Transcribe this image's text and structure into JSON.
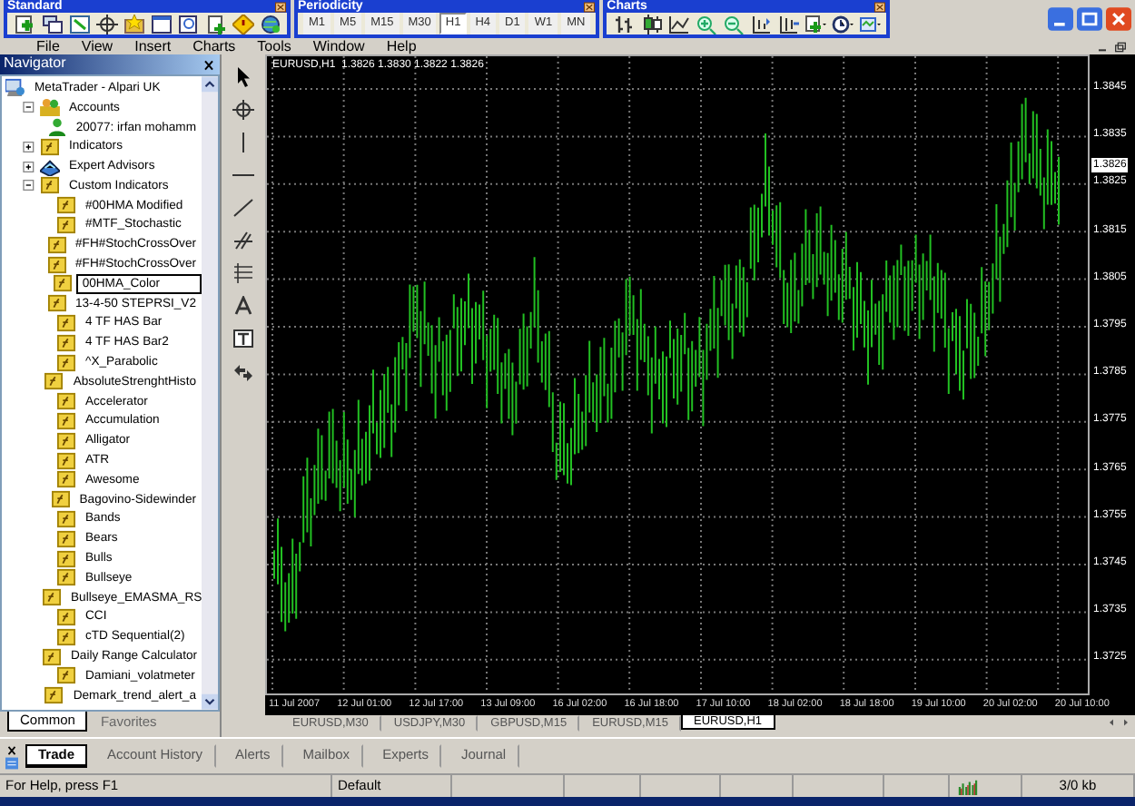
{
  "toolbars": {
    "standard": {
      "title": "Standard"
    },
    "periodicity": {
      "title": "Periodicity",
      "buttons": [
        {
          "label": "M1",
          "selected": false
        },
        {
          "label": "M5",
          "selected": false
        },
        {
          "label": "M15",
          "selected": false
        },
        {
          "label": "M30",
          "selected": false
        },
        {
          "label": "H1",
          "selected": true
        },
        {
          "label": "H4",
          "selected": false
        },
        {
          "label": "D1",
          "selected": false
        },
        {
          "label": "W1",
          "selected": false
        },
        {
          "label": "MN",
          "selected": false
        }
      ]
    },
    "charts": {
      "title": "Charts"
    }
  },
  "menu": [
    "File",
    "View",
    "Insert",
    "Charts",
    "Tools",
    "Window",
    "Help"
  ],
  "navigator": {
    "title": "Navigator",
    "tree": [
      {
        "label": "MetaTrader - Alpari UK",
        "kind": "root",
        "selected": false,
        "children": [
          {
            "label": "Accounts",
            "kind": "accounts",
            "expanded": true,
            "selected": false,
            "children": [
              {
                "label": "20077: irfan mohamm",
                "kind": "account",
                "selected": false
              }
            ]
          },
          {
            "label": "Indicators",
            "kind": "folder",
            "expanded": false,
            "selected": false
          },
          {
            "label": "Expert Advisors",
            "kind": "experts",
            "expanded": false,
            "selected": false
          },
          {
            "label": "Custom Indicators",
            "kind": "folder",
            "expanded": true,
            "selected": false,
            "children": [
              {
                "label": "#00HMA Modified",
                "kind": "script",
                "selected": false
              },
              {
                "label": "#MTF_Stochastic",
                "kind": "script",
                "selected": false
              },
              {
                "label": "#FH#StochCrossOver",
                "kind": "script",
                "selected": false
              },
              {
                "label": "#FH#StochCrossOver",
                "kind": "script",
                "selected": false
              },
              {
                "label": "00HMA_Color",
                "kind": "script",
                "selected": true
              },
              {
                "label": "13-4-50 STEPRSI_V2",
                "kind": "script",
                "selected": false
              },
              {
                "label": "4 TF HAS Bar",
                "kind": "script",
                "selected": false
              },
              {
                "label": "4 TF HAS Bar2",
                "kind": "script",
                "selected": false
              },
              {
                "label": "^X_Parabolic",
                "kind": "script",
                "selected": false
              },
              {
                "label": "AbsoluteStrenghtHisto",
                "kind": "script",
                "selected": false
              },
              {
                "label": "Accelerator",
                "kind": "script",
                "selected": false
              },
              {
                "label": "Accumulation",
                "kind": "script",
                "selected": false
              },
              {
                "label": "Alligator",
                "kind": "script",
                "selected": false
              },
              {
                "label": "ATR",
                "kind": "script",
                "selected": false
              },
              {
                "label": "Awesome",
                "kind": "script",
                "selected": false
              },
              {
                "label": "Bagovino-Sidewinder",
                "kind": "script",
                "selected": false
              },
              {
                "label": "Bands",
                "kind": "script",
                "selected": false
              },
              {
                "label": "Bears",
                "kind": "script",
                "selected": false
              },
              {
                "label": "Bulls",
                "kind": "script",
                "selected": false
              },
              {
                "label": "Bullseye",
                "kind": "script",
                "selected": false
              },
              {
                "label": "Bullseye_EMASMA_RS",
                "kind": "script",
                "selected": false
              },
              {
                "label": "CCI",
                "kind": "script",
                "selected": false
              },
              {
                "label": "cTD Sequential(2)",
                "kind": "script",
                "selected": false
              },
              {
                "label": "Daily Range Calculator",
                "kind": "script",
                "selected": false
              },
              {
                "label": "Damiani_volatmeter",
                "kind": "script",
                "selected": false
              },
              {
                "label": "Demark_trend_alert_a",
                "kind": "script",
                "selected": false
              }
            ]
          }
        ]
      }
    ],
    "tabs": [
      {
        "label": "Common",
        "selected": true
      },
      {
        "label": "Favorites",
        "selected": false
      }
    ]
  },
  "chart": {
    "header": "EURUSD,H1  1.3826 1.3830 1.3822 1.3826",
    "current_price": "1.3826",
    "price_labels": [
      "1.3845",
      "1.3835",
      "1.3825",
      "1.3815",
      "1.3805",
      "1.3795",
      "1.3785",
      "1.3775",
      "1.3765",
      "1.3755",
      "1.3745",
      "1.3735",
      "1.3725"
    ],
    "time_labels": [
      "11 Jul 2007",
      "12 Jul 01:00",
      "12 Jul 17:00",
      "13 Jul 09:00",
      "16 Jul 02:00",
      "16 Jul 18:00",
      "17 Jul 10:00",
      "18 Jul 02:00",
      "18 Jul 18:00",
      "19 Jul 10:00",
      "20 Jul 02:00",
      "20 Jul 10:00"
    ]
  },
  "chart_tabs": [
    {
      "label": "EURUSD,M30",
      "selected": false
    },
    {
      "label": "USDJPY,M30",
      "selected": false
    },
    {
      "label": "GBPUSD,M15",
      "selected": false
    },
    {
      "label": "EURUSD,M15",
      "selected": false
    },
    {
      "label": "EURUSD,H1",
      "selected": true
    }
  ],
  "terminal_tabs": [
    {
      "label": "Trade",
      "selected": true
    },
    {
      "label": "Account History",
      "selected": false
    },
    {
      "label": "Alerts",
      "selected": false
    },
    {
      "label": "Mailbox",
      "selected": false
    },
    {
      "label": "Experts",
      "selected": false
    },
    {
      "label": "Journal",
      "selected": false
    }
  ],
  "status_bar": {
    "help": "For Help, press F1",
    "profile": "Default",
    "traffic": "3/0 kb"
  }
}
